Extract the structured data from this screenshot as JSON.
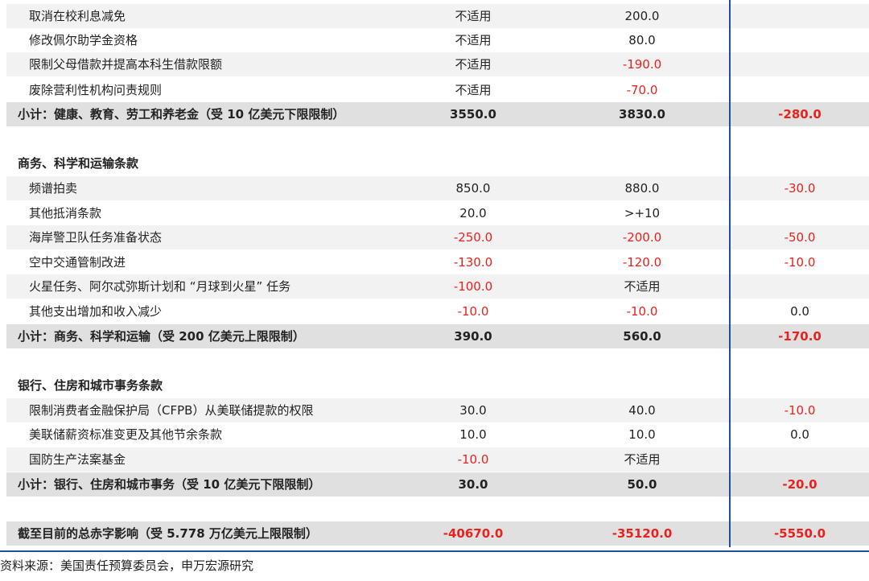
{
  "rows": [
    {
      "kind": "item",
      "label": "取消在校利息减免",
      "c1": "不适用",
      "c2": "200.0",
      "c3": ""
    },
    {
      "kind": "item",
      "label": "修改佩尔助学金资格",
      "c1": "不适用",
      "c2": "80.0",
      "c3": ""
    },
    {
      "kind": "item",
      "label": "限制父母借款并提高本科生借款限额",
      "c1": "不适用",
      "c2": "-190.0",
      "c3": ""
    },
    {
      "kind": "item",
      "label": "废除营利性机构问责规则",
      "c1": "不适用",
      "c2": "-70.0",
      "c3": ""
    },
    {
      "kind": "subtotal",
      "label": "小计：健康、教育、劳工和养老金（受 10 亿美元下限限制）",
      "c1": "3550.0",
      "c2": "3830.0",
      "c3": "-280.0"
    },
    {
      "kind": "blank"
    },
    {
      "kind": "header",
      "label": "商务、科学和运输条款"
    },
    {
      "kind": "item",
      "label": "频谱拍卖",
      "c1": "850.0",
      "c2": "880.0",
      "c3": "-30.0"
    },
    {
      "kind": "item",
      "label": "其他抵消条款",
      "c1": "20.0",
      "c2": ">+10",
      "c3": ""
    },
    {
      "kind": "item",
      "label": "海岸警卫队任务准备状态",
      "c1": "-250.0",
      "c2": "-200.0",
      "c3": "-50.0"
    },
    {
      "kind": "item",
      "label": "空中交通管制改进",
      "c1": "-130.0",
      "c2": "-120.0",
      "c3": "-10.0"
    },
    {
      "kind": "item",
      "label": "火星任务、阿尔忒弥斯计划和 “月球到火星” 任务",
      "c1": "-100.0",
      "c2": "不适用",
      "c3": ""
    },
    {
      "kind": "item",
      "label": "其他支出增加和收入减少",
      "c1": "-10.0",
      "c2": "-10.0",
      "c3": "0.0"
    },
    {
      "kind": "subtotal",
      "label": "小计：商务、科学和运输（受 200 亿美元上限限制）",
      "c1": "390.0",
      "c2": "560.0",
      "c3": "-170.0"
    },
    {
      "kind": "blank"
    },
    {
      "kind": "header",
      "label": "银行、住房和城市事务条款"
    },
    {
      "kind": "item",
      "label": "限制消费者金融保护局（CFPB）从美联储提款的权限",
      "c1": "30.0",
      "c2": "40.0",
      "c3": "-10.0"
    },
    {
      "kind": "item",
      "label": "美联储薪资标准变更及其他节余条款",
      "c1": "10.0",
      "c2": "10.0",
      "c3": "0.0"
    },
    {
      "kind": "item",
      "label": "国防生产法案基金",
      "c1": "-10.0",
      "c2": "不适用",
      "c3": ""
    },
    {
      "kind": "subtotal",
      "label": "小计：银行、住房和城市事务（受 10 亿美元下限限制）",
      "c1": "30.0",
      "c2": "50.0",
      "c3": "-20.0"
    },
    {
      "kind": "blank"
    },
    {
      "kind": "total",
      "label": "截至目前的总赤字影响（受 5.778 万亿美元上限限制）",
      "c1": "-40670.0",
      "c2": "-35120.0",
      "c3": "-5550.0"
    }
  ],
  "source": "资料来源：美国责任预算委员会，申万宏源研究",
  "colors": {
    "negative": "#e8221e",
    "rule": "#1f4e9c",
    "row_shade": "#f2f2f2",
    "subtotal_bg": "#e0e0e0"
  }
}
